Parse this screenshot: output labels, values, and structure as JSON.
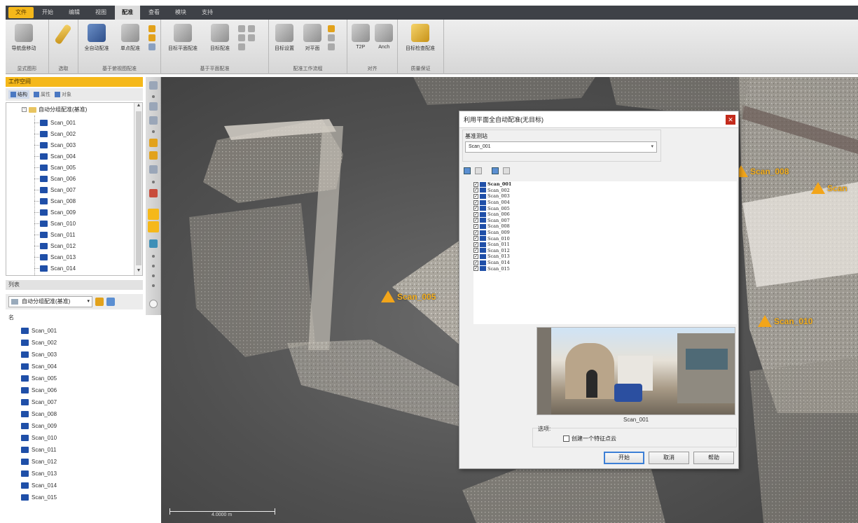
{
  "menu": {
    "tabs": [
      "文件",
      "开始",
      "编辑",
      "视图",
      "配准",
      "查看",
      "模块",
      "支持"
    ],
    "active_index": 4
  },
  "ribbon": {
    "groups": [
      {
        "label": "显式图形",
        "buttons": [
          {
            "label": "导航盘移动",
            "icon": "navigation-icon",
            "tone": "grey"
          }
        ]
      },
      {
        "label": "选取",
        "buttons": [
          {
            "label": "",
            "icon": "pencil-icon",
            "tone": "gold"
          }
        ]
      },
      {
        "label": "基于俯视图配准",
        "buttons": [
          {
            "label": "全自动配准",
            "icon": "auto-register-icon",
            "tone": "blue"
          },
          {
            "label": "单点配准",
            "icon": "cloud-register-icon",
            "tone": "grey"
          }
        ]
      },
      {
        "label": "基于平面配准",
        "buttons": [
          {
            "label": "目标平面配准",
            "icon": "plane-register-icon",
            "tone": "grey"
          },
          {
            "label": "目标配准",
            "icon": "target-register-icon",
            "tone": "grey"
          }
        ]
      },
      {
        "label": "配准工作流程",
        "buttons": [
          {
            "label": "目标设置",
            "icon": "target-settings-icon",
            "tone": "grey"
          },
          {
            "label": "对平面",
            "icon": "plane-align-icon",
            "tone": "grey"
          }
        ]
      },
      {
        "label": "对齐",
        "buttons": [
          {
            "label": "T2P",
            "icon": "t2p-icon",
            "tone": "grey"
          },
          {
            "label": "Anch",
            "icon": "anchor-icon",
            "tone": "grey"
          }
        ]
      },
      {
        "label": "质量保证",
        "buttons": [
          {
            "label": "目标检查配准",
            "icon": "quality-check-icon",
            "tone": "gold"
          }
        ]
      }
    ]
  },
  "workspace": {
    "title": "工作空间",
    "tabs": [
      "结构",
      "属性",
      "对象"
    ],
    "root_label": "自动分组配准(基准)",
    "items": [
      "Scan_001",
      "Scan_002",
      "Scan_003",
      "Scan_004",
      "Scan_005",
      "Scan_006",
      "Scan_007",
      "Scan_008",
      "Scan_009",
      "Scan_010",
      "Scan_011",
      "Scan_012",
      "Scan_013",
      "Scan_014"
    ]
  },
  "list_panel": {
    "title": "列表",
    "selected": "自动分组配准(基准)",
    "root_label": "名",
    "items": [
      "Scan_001",
      "Scan_002",
      "Scan_003",
      "Scan_004",
      "Scan_005",
      "Scan_006",
      "Scan_007",
      "Scan_008",
      "Scan_009",
      "Scan_010",
      "Scan_011",
      "Scan_012",
      "Scan_013",
      "Scan_014",
      "Scan_015"
    ]
  },
  "viewport": {
    "markers": [
      "Scan_005",
      "Scan_008",
      "Scan",
      "Scan_010"
    ],
    "scale_text": "4.0000 m"
  },
  "dialog": {
    "title": "利用平面全自动配准(无目标)",
    "reference_label": "基准测站",
    "reference_value": "Scan_001",
    "scans": [
      {
        "name": "Scan_001",
        "checked": true
      },
      {
        "name": "Scan_002",
        "checked": true
      },
      {
        "name": "Scan_003",
        "checked": true
      },
      {
        "name": "Scan_004",
        "checked": true
      },
      {
        "name": "Scan_005",
        "checked": true
      },
      {
        "name": "Scan_006",
        "checked": true
      },
      {
        "name": "Scan_007",
        "checked": true
      },
      {
        "name": "Scan_008",
        "checked": true
      },
      {
        "name": "Scan_009",
        "checked": true
      },
      {
        "name": "Scan_010",
        "checked": true
      },
      {
        "name": "Scan_011",
        "checked": true
      },
      {
        "name": "Scan_012",
        "checked": true
      },
      {
        "name": "Scan_013",
        "checked": true
      },
      {
        "name": "Scan_014",
        "checked": true
      },
      {
        "name": "Scan_015",
        "checked": true
      }
    ],
    "preview_label": "Scan_001",
    "options_label": "选项:",
    "option_checkbox": "创建一个特征点云",
    "buttons": {
      "start": "开始",
      "cancel": "取消",
      "help": "帮助"
    }
  },
  "colors": {
    "accent": "#f5b81a",
    "marker": "#f2a51a",
    "scan_icon": "#1f4fa8"
  }
}
